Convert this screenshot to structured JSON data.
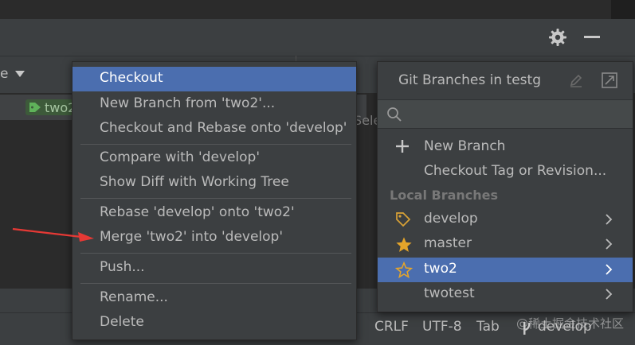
{
  "context_menu": {
    "items": [
      {
        "label": "Checkout",
        "selected": true
      },
      {
        "label": "New Branch from 'two2'..."
      },
      {
        "label": "Checkout and Rebase onto 'develop'"
      },
      {
        "label": "Compare with 'develop'"
      },
      {
        "label": "Show Diff with Working Tree"
      },
      {
        "label": "Rebase 'develop' onto 'two2'"
      },
      {
        "label": "Merge 'two2' into 'develop'"
      },
      {
        "label": "Push..."
      },
      {
        "label": "Rename..."
      },
      {
        "label": "Delete"
      }
    ]
  },
  "branches_popup": {
    "title": "Git Branches in testg",
    "actions": [
      {
        "label": "New Branch",
        "icon": "plus-icon"
      },
      {
        "label": "Checkout Tag or Revision...",
        "icon": ""
      }
    ],
    "section_local": "Local Branches",
    "local_branches": [
      {
        "name": "develop",
        "icon": "tag-icon"
      },
      {
        "name": "master",
        "icon": "star-filled-icon"
      },
      {
        "name": "two2",
        "icon": "star-outline-icon",
        "selected": true
      },
      {
        "name": "twotest",
        "icon": ""
      }
    ]
  },
  "log": {
    "row_tag": "two2",
    "partial_text": "Sele"
  },
  "header": {
    "partial_column": "e"
  },
  "status_bar": {
    "line_sep": "CRLF",
    "encoding": "UTF-8",
    "indent": "Tab",
    "branch": "develop"
  },
  "watermark": "@稀土掘金技术社区",
  "colors": {
    "selection": "#4b6eaf",
    "background": "#3c3f41",
    "star": "#e5a52a",
    "arrow": "#e53935"
  }
}
